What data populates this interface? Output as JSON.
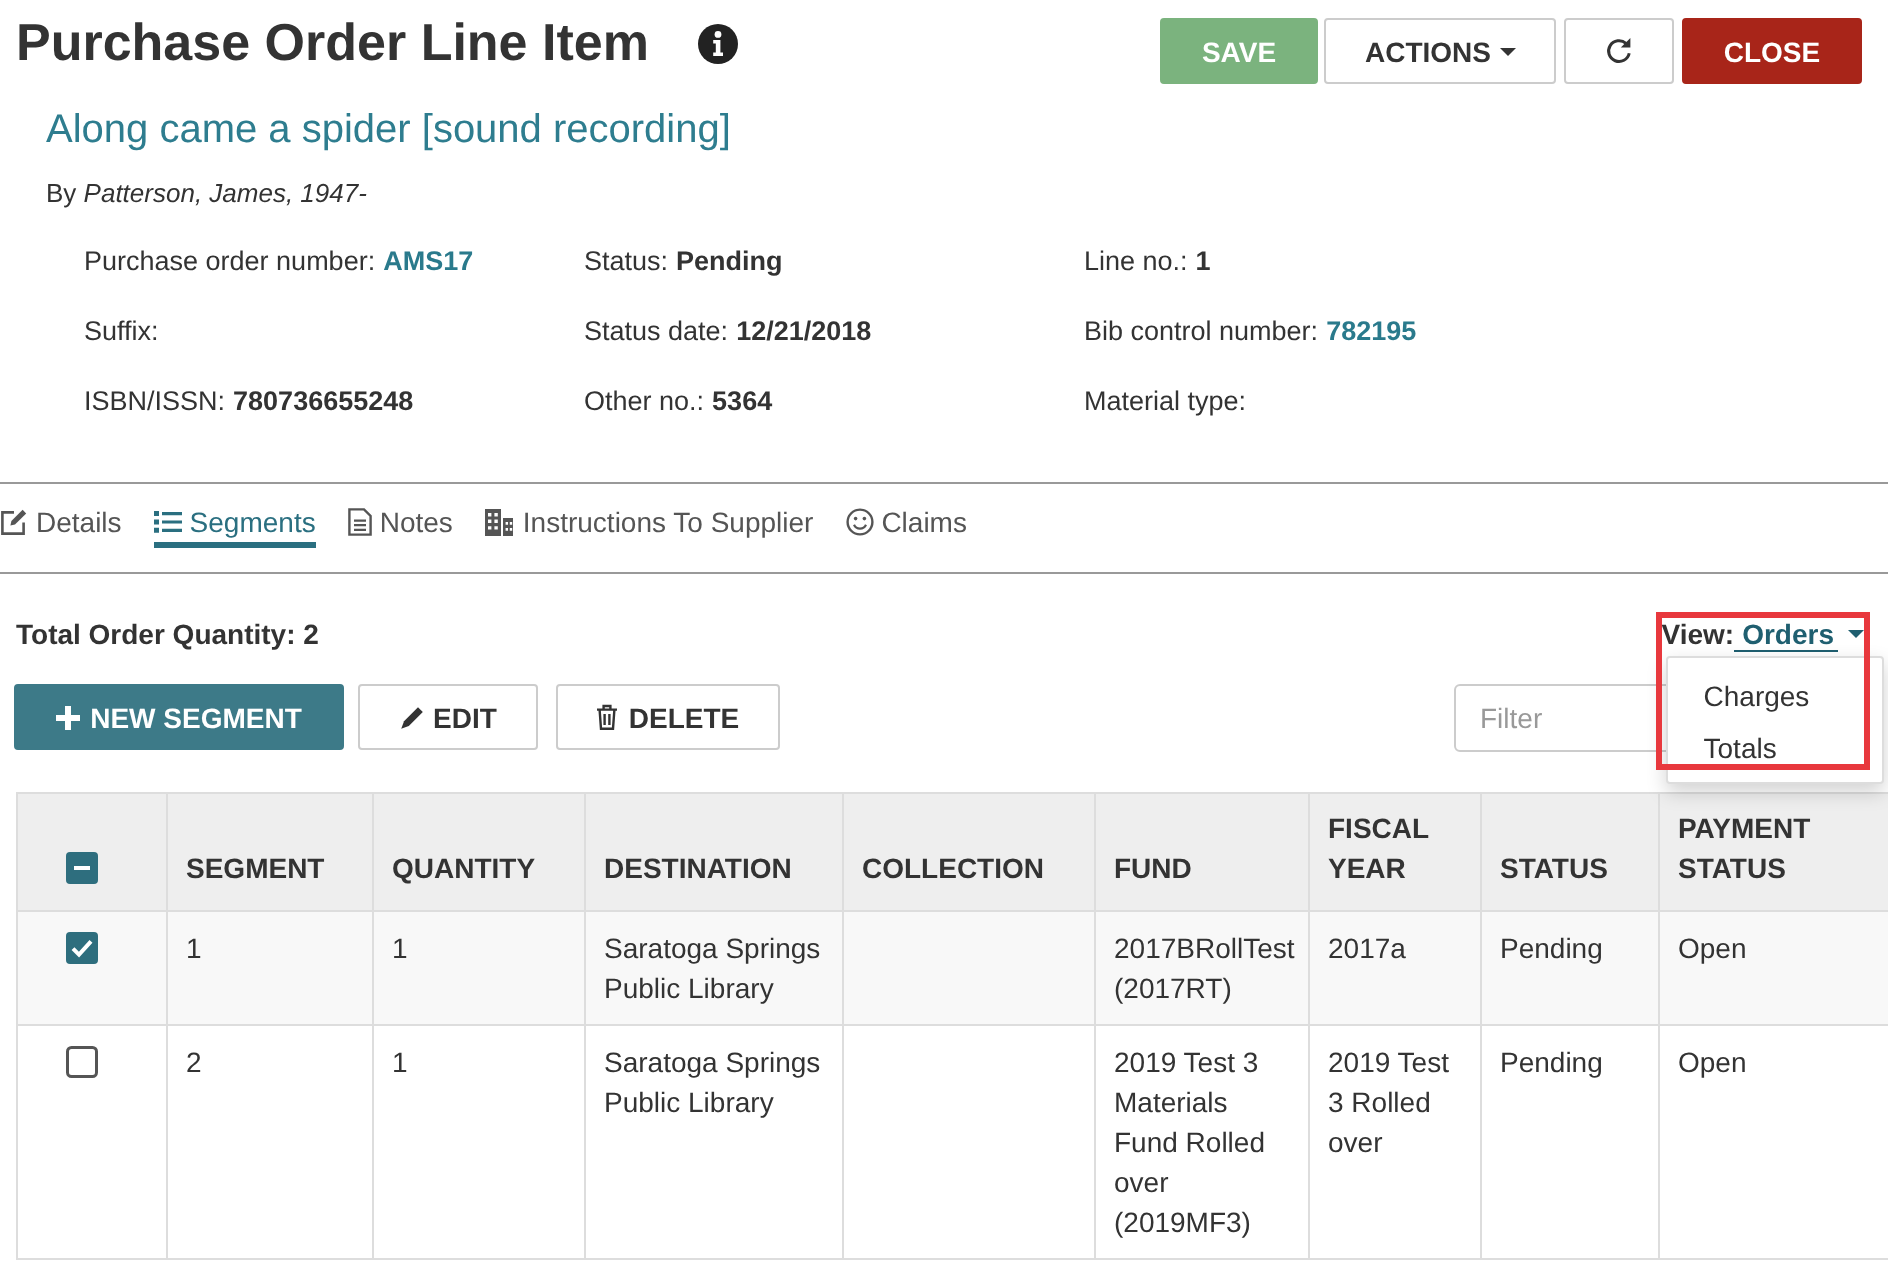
{
  "header": {
    "title": "Purchase Order Line Item",
    "buttons": [
      {
        "label": "SAVE",
        "kind": "success",
        "disabled": true
      },
      {
        "label": "ACTIONS",
        "kind": "dropdown",
        "disabled": false
      },
      {
        "kind": "icon",
        "disabled": false
      },
      {
        "label": "CLOSE",
        "kind": "danger",
        "disabled": false
      }
    ]
  },
  "record": {
    "title": "Along came a spider [sound recording]",
    "byline": "By *Patterson, James, 1947-*",
    "fields": [
      {
        "label": "Purchase order number:",
        "value": "AMS17",
        "link": true
      },
      {
        "label": "Status:",
        "value": "Pending",
        "link": false
      },
      {
        "label": "Line no.:",
        "value": "1",
        "link": false
      },
      {
        "label": "Suffix:"
      },
      {
        "label": "Status date:",
        "value": "12/21/2018",
        "link": false
      },
      {
        "label": "Bib control number:",
        "value": "782195",
        "link": true
      },
      {
        "label": "ISBN/ISSN:",
        "value": "780736655248",
        "link": false
      },
      {
        "label": "Other no.:",
        "value": "5364",
        "link": false
      },
      {
        "label": "Material type:"
      }
    ]
  },
  "tabs": [
    {
      "label": "Details",
      "selected": false
    },
    {
      "label": "Segments",
      "selected": true
    },
    {
      "label": "Notes",
      "selected": false
    },
    {
      "label": "Instructions To Supplier",
      "selected": false
    },
    {
      "label": "Claims",
      "selected": false
    }
  ],
  "segments": {
    "total": "Total Order Quantity: 2",
    "view": {
      "label": "View:",
      "value": "Orders",
      "expanded": true,
      "highlighted": true,
      "options": [
        "Charges",
        "Totals"
      ]
    },
    "actions": [
      {
        "label": "NEW SEGMENT",
        "kind": "add"
      },
      {
        "label": "EDIT",
        "kind": "edit"
      },
      {
        "label": "DELETE",
        "kind": "delete"
      }
    ],
    "filter": {
      "placeholder": "Filter"
    },
    "table": {
      "select_all": {
        "indeterminate": true
      },
      "columns": [
        "SEGMENT",
        "QUANTITY",
        "DESTINATION",
        "COLLECTION",
        "FUND",
        "FISCAL YEAR",
        "STATUS",
        "PAYMENT STATUS"
      ],
      "rows": [
        {
          "selected": true,
          "cells": [
            "1",
            "1",
            "Saratoga Springs Public Library",
            null,
            "2017BRollTest (2017RT)",
            "2017a",
            "Pending",
            "Open"
          ]
        },
        {
          "selected": false,
          "cells": [
            "2",
            "1",
            "Saratoga Springs Public Library",
            null,
            "2019 Test 3 Materials Fund Rolled over (2019MF3)",
            "2019 Test 3 Rolled over",
            "Pending",
            "Open"
          ]
        }
      ]
    }
  }
}
